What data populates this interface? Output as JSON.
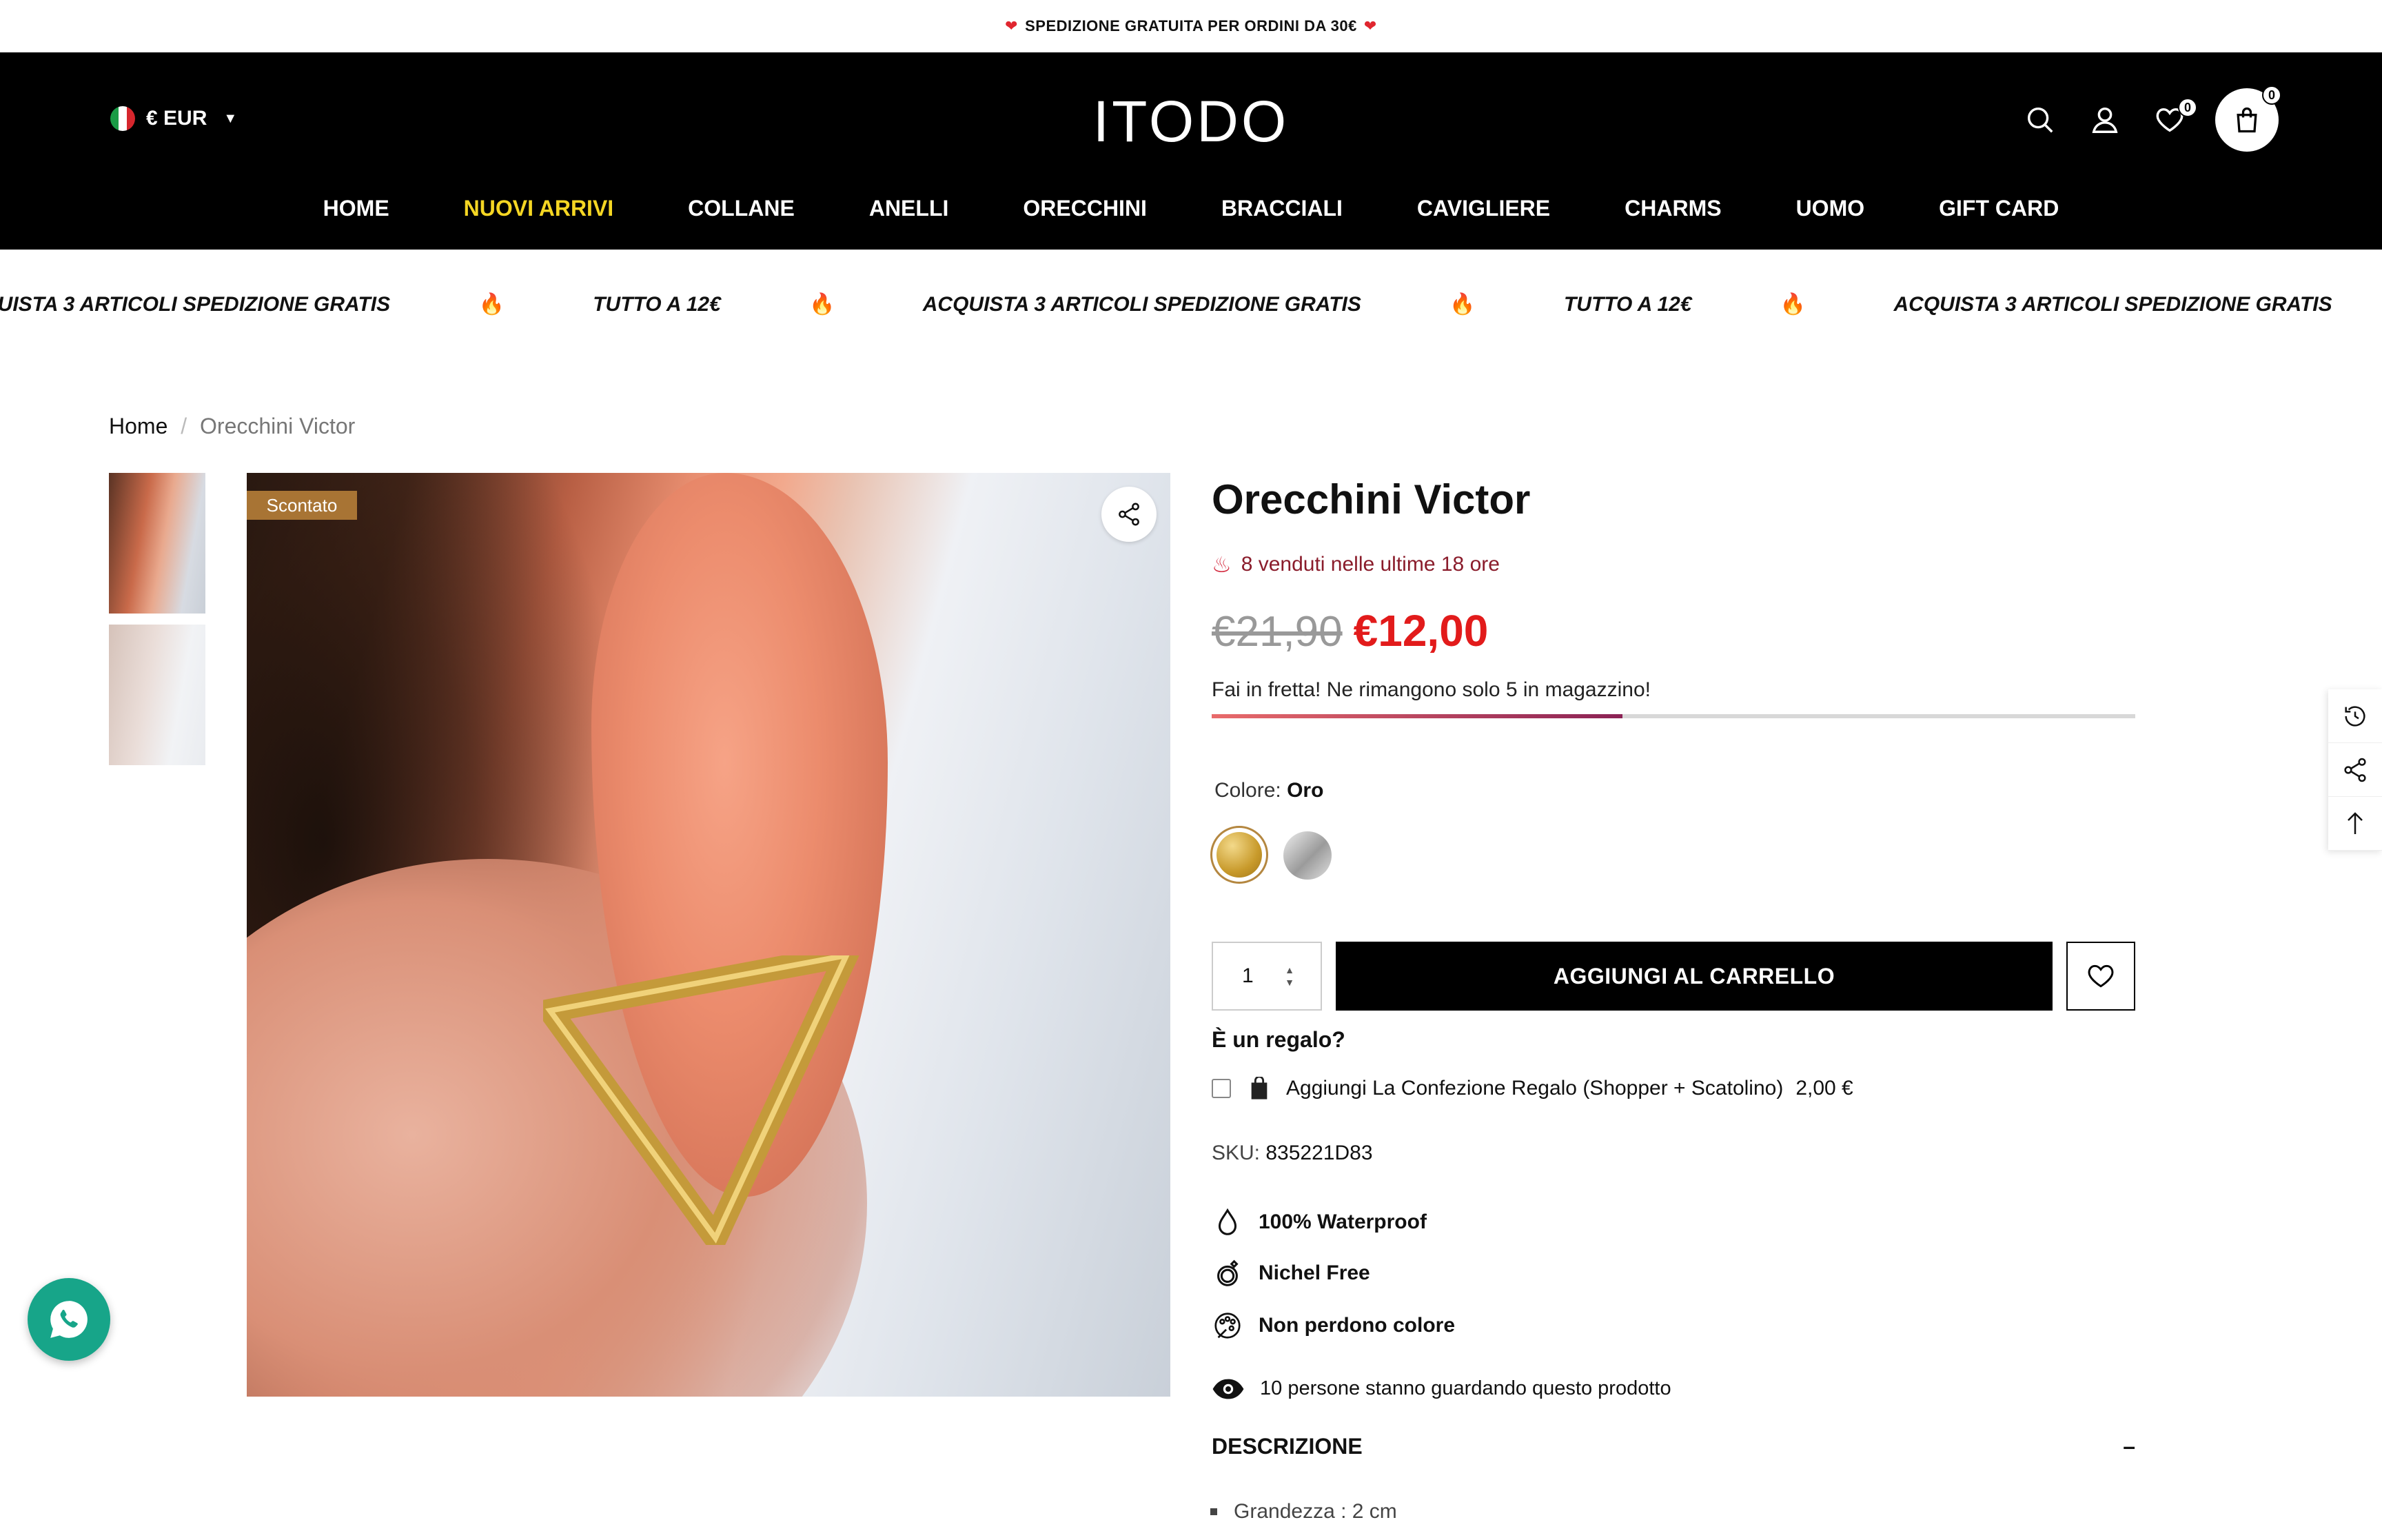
{
  "announcement": {
    "text": "SPEDIZIONE GRATUITA PER ORDINI DA 30€"
  },
  "header": {
    "currency": "€ EUR",
    "logo": "ITODO",
    "wishlist_count": "0",
    "cart_count": "0",
    "nav": [
      "HOME",
      "NUOVI ARRIVI",
      "COLLANE",
      "ANELLI",
      "ORECCHINI",
      "BRACCIALI",
      "CAVIGLIERE",
      "CHARMS",
      "UOMO",
      "GIFT CARD"
    ],
    "active_nav": "NUOVI ARRIVI"
  },
  "marquee": {
    "price_promo": "TUTTO A 12€",
    "shipping_promo": "ACQUISTA 3 ARTICOLI SPEDIZIONE GRATIS"
  },
  "breadcrumb": {
    "home": "Home",
    "current": "Orecchini Victor"
  },
  "product": {
    "badge": "Scontato",
    "title": "Orecchini Victor",
    "sold_recently": "8 venduti nelle ultime 18 ore",
    "old_price": "€21,90",
    "price": "€12,00",
    "stock_text": "Fai in fretta! Ne rimangono solo 5 in magazzino!",
    "stock_level": 0.445,
    "color_label": "Colore:",
    "color_value": "Oro",
    "quantity": "1",
    "add_to_cart": "AGGIUNGI AL CARRELLO",
    "gift_question": "È un regalo?",
    "gift_option": "Aggiungi La Confezione Regalo (Shopper + Scatolino)",
    "gift_price": "2,00 €",
    "sku_label": "SKU:",
    "sku": "835221D83",
    "features": [
      "100% Waterproof",
      "Nichel Free",
      "Non perdono colore"
    ],
    "viewers": "10 persone stanno guardando questo prodotto",
    "description_title": "DESCRIZIONE",
    "description_items": [
      "Grandezza : 2 cm"
    ]
  },
  "colors": {
    "accent_nav": "#f5d623",
    "sale_price": "#e21b1b",
    "badge": "#a87434",
    "whatsapp": "#17a589"
  }
}
